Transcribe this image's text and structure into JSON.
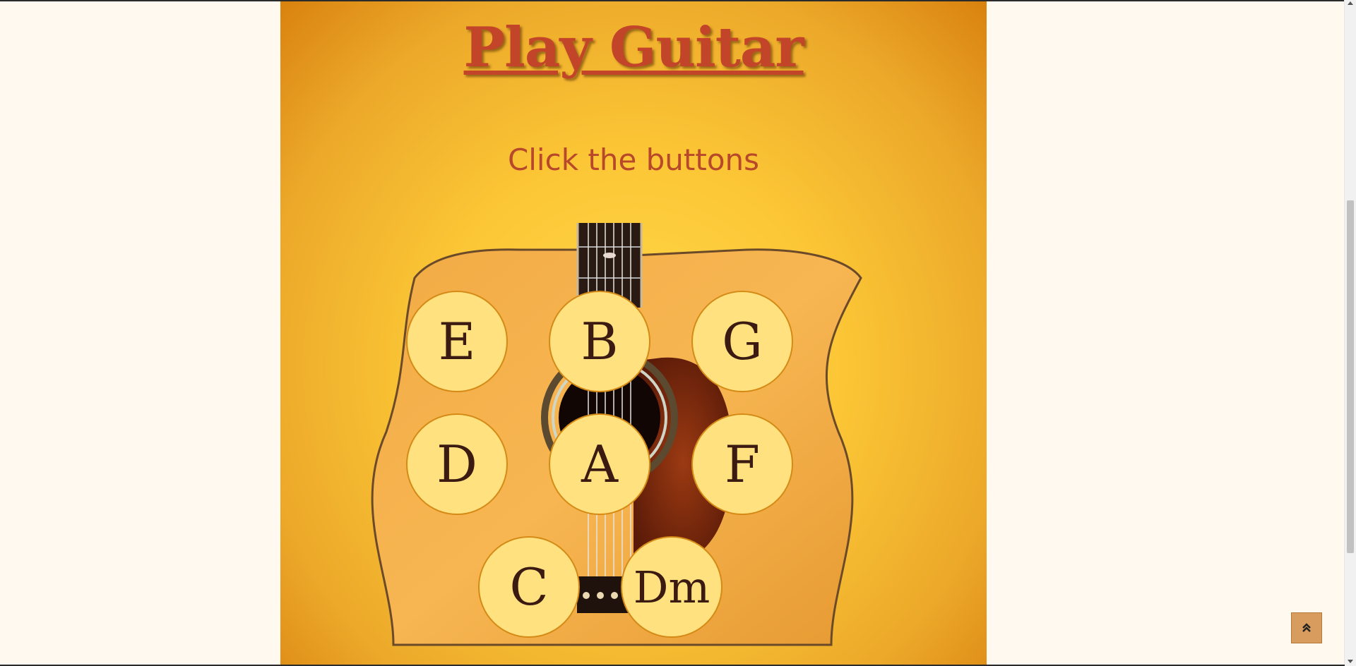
{
  "title": "Play Guitar",
  "subtitle": "Click the buttons",
  "buttons": [
    {
      "label": "E"
    },
    {
      "label": "B"
    },
    {
      "label": "G"
    },
    {
      "label": "D"
    },
    {
      "label": "A"
    },
    {
      "label": "F"
    },
    {
      "label": "C"
    },
    {
      "label": "Dm"
    }
  ],
  "to_top": {
    "icon": "double-chevron-up-icon",
    "glyph": "»"
  },
  "colors": {
    "page_bg": "#fff9f0",
    "title": "#c2452a",
    "button_fill": "#ffe27f",
    "button_border": "#d58a16",
    "button_text": "#3b1a12"
  }
}
